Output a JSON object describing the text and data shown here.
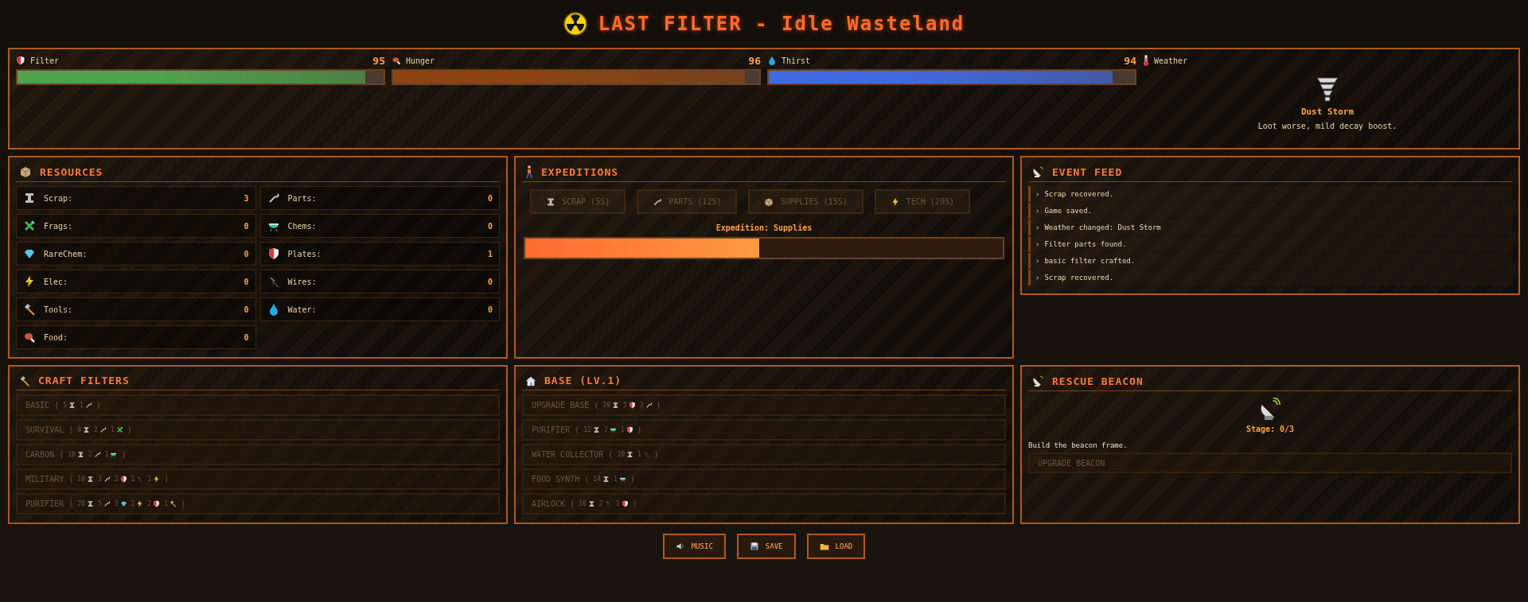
{
  "title": {
    "text": "LAST FILTER - Idle Wasteland"
  },
  "stats": [
    {
      "kind": "filter",
      "label": "Filter",
      "value": "95",
      "level": 0.95,
      "color": "#4fa34f"
    },
    {
      "kind": "hunger",
      "label": "Hunger",
      "value": "96",
      "level": 0.96,
      "color": "#8b4513"
    },
    {
      "kind": "thirst",
      "label": "Thirst",
      "value": "94",
      "level": 0.94,
      "color": "#4169e1"
    }
  ],
  "weather": {
    "label": "Weather",
    "name": "Dust Storm",
    "description": "Loot worse, mild decay boost."
  },
  "resources": {
    "title": "RESOURCES",
    "items": [
      {
        "kind": "scrap",
        "label": "Scrap:",
        "value": "3"
      },
      {
        "kind": "parts",
        "label": "Parts:",
        "value": "0"
      },
      {
        "kind": "frags",
        "label": "Frags:",
        "value": "0"
      },
      {
        "kind": "chems",
        "label": "Chems:",
        "value": "0"
      },
      {
        "kind": "rarechem",
        "label": "RareChem:",
        "value": "0"
      },
      {
        "kind": "plates",
        "label": "Plates:",
        "value": "1"
      },
      {
        "kind": "elec",
        "label": "Elec:",
        "value": "0"
      },
      {
        "kind": "wires",
        "label": "Wires:",
        "value": "0"
      },
      {
        "kind": "tools",
        "label": "Tools:",
        "value": "0"
      },
      {
        "kind": "water",
        "label": "Water:",
        "value": "0"
      },
      {
        "kind": "food",
        "label": "Food:",
        "value": "0"
      }
    ]
  },
  "expeditions": {
    "title": "EXPEDITIONS",
    "buttons": [
      {
        "kind": "scrap",
        "label": "SCRAP (5S)",
        "disabled": true
      },
      {
        "kind": "parts",
        "label": "PARTS (12S)",
        "disabled": true
      },
      {
        "kind": "supplies",
        "label": "SUPPLIES (15S)",
        "disabled": true
      },
      {
        "kind": "elec",
        "label": "TECH (20S)",
        "disabled": true
      }
    ],
    "status": "Expedition: Supplies",
    "level": 0.49
  },
  "event_feed": {
    "title": "EVENT FEED",
    "entries": [
      {
        "marker": "›",
        "text": "Scrap recovered."
      },
      {
        "marker": "›",
        "text": "Game saved."
      },
      {
        "marker": "›",
        "text": "Weather changed: Dust Storm"
      },
      {
        "marker": "›",
        "text": "Filter parts found."
      },
      {
        "marker": "›",
        "text": "basic filter crafted."
      },
      {
        "marker": "›",
        "text": "Scrap recovered."
      }
    ]
  },
  "craft_filters": {
    "title": "CRAFT FILTERS",
    "recipes": [
      {
        "name": "BASIC",
        "disabled": true,
        "open": "(",
        "close": ")",
        "cost": [
          {
            "amount": "5",
            "kind": "scrap"
          },
          {
            "amount": "1",
            "kind": "parts"
          }
        ]
      },
      {
        "name": "SURVIVAL",
        "disabled": true,
        "open": "(",
        "close": ")",
        "cost": [
          {
            "amount": "8",
            "kind": "scrap"
          },
          {
            "amount": "2",
            "kind": "parts"
          },
          {
            "amount": "1",
            "kind": "frags"
          }
        ]
      },
      {
        "name": "CARBON",
        "disabled": true,
        "open": "(",
        "close": ")",
        "cost": [
          {
            "amount": "10",
            "kind": "scrap"
          },
          {
            "amount": "2",
            "kind": "parts"
          },
          {
            "amount": "1",
            "kind": "chems"
          }
        ]
      },
      {
        "name": "MILITARY",
        "disabled": true,
        "open": "(",
        "close": ")",
        "cost": [
          {
            "amount": "10",
            "kind": "scrap"
          },
          {
            "amount": "3",
            "kind": "parts"
          },
          {
            "amount": "2",
            "kind": "plates"
          },
          {
            "amount": "1",
            "kind": "wires"
          },
          {
            "amount": "1",
            "kind": "elec"
          }
        ]
      },
      {
        "name": "PURIFIER",
        "disabled": true,
        "open": "(",
        "close": ")",
        "cost": [
          {
            "amount": "20",
            "kind": "scrap"
          },
          {
            "amount": "5",
            "kind": "parts"
          },
          {
            "amount": "3",
            "kind": "rarechem"
          },
          {
            "amount": "2",
            "kind": "elec"
          },
          {
            "amount": "2",
            "kind": "plates"
          },
          {
            "amount": "1",
            "kind": "tools"
          }
        ]
      }
    ]
  },
  "base": {
    "title": "BASE (LV.1)",
    "upgrades": [
      {
        "name": "UPGRADE BASE",
        "disabled": true,
        "open": "(",
        "close": ")",
        "cost": [
          {
            "amount": "20",
            "kind": "scrap"
          },
          {
            "amount": "5",
            "kind": "plates"
          },
          {
            "amount": "3",
            "kind": "parts"
          }
        ]
      },
      {
        "name": "PURIFIER",
        "disabled": true,
        "open": "(",
        "close": ")",
        "cost": [
          {
            "amount": "12",
            "kind": "scrap"
          },
          {
            "amount": "2",
            "kind": "chems"
          },
          {
            "amount": "1",
            "kind": "plates"
          }
        ]
      },
      {
        "name": "WATER COLLECTOR",
        "disabled": true,
        "open": "(",
        "close": ")",
        "cost": [
          {
            "amount": "10",
            "kind": "scrap"
          },
          {
            "amount": "1",
            "kind": "wires"
          }
        ]
      },
      {
        "name": "FOOD SYNTH",
        "disabled": true,
        "open": "(",
        "close": ")",
        "cost": [
          {
            "amount": "14",
            "kind": "scrap"
          },
          {
            "amount": "1",
            "kind": "chems"
          }
        ]
      },
      {
        "name": "AIRLOCK",
        "disabled": true,
        "open": "(",
        "close": ")",
        "cost": [
          {
            "amount": "10",
            "kind": "scrap"
          },
          {
            "amount": "2",
            "kind": "wires"
          },
          {
            "amount": "1",
            "kind": "plates"
          }
        ]
      }
    ]
  },
  "rescue_beacon": {
    "title": "RESCUE BEACON",
    "stage": "Stage: 0/3",
    "description": "Build the beacon frame.",
    "button": {
      "label": "UPGRADE BEACON",
      "disabled": true
    }
  },
  "footer_buttons": [
    {
      "kind": "music",
      "label": "MUSIC"
    },
    {
      "kind": "save",
      "label": "SAVE"
    },
    {
      "kind": "load",
      "label": "LOAD"
    }
  ]
}
